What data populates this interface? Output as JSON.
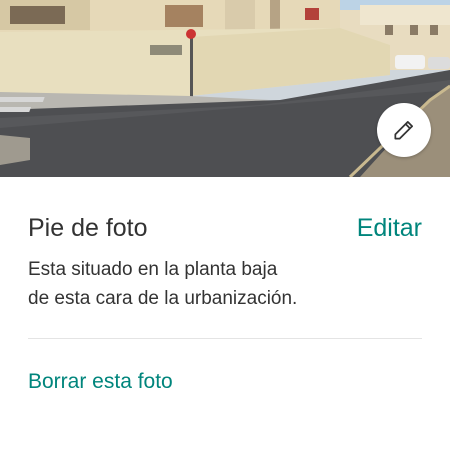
{
  "photo": {
    "edit_icon": "pencil-icon"
  },
  "caption": {
    "title": "Pie de foto",
    "edit_label": "Editar",
    "text": "Esta situado en la planta baja\nde esta cara de la urbanización."
  },
  "actions": {
    "delete_label": "Borrar esta foto"
  },
  "colors": {
    "accent": "#00857c",
    "text": "#333333",
    "divider": "#e4e4e4"
  }
}
